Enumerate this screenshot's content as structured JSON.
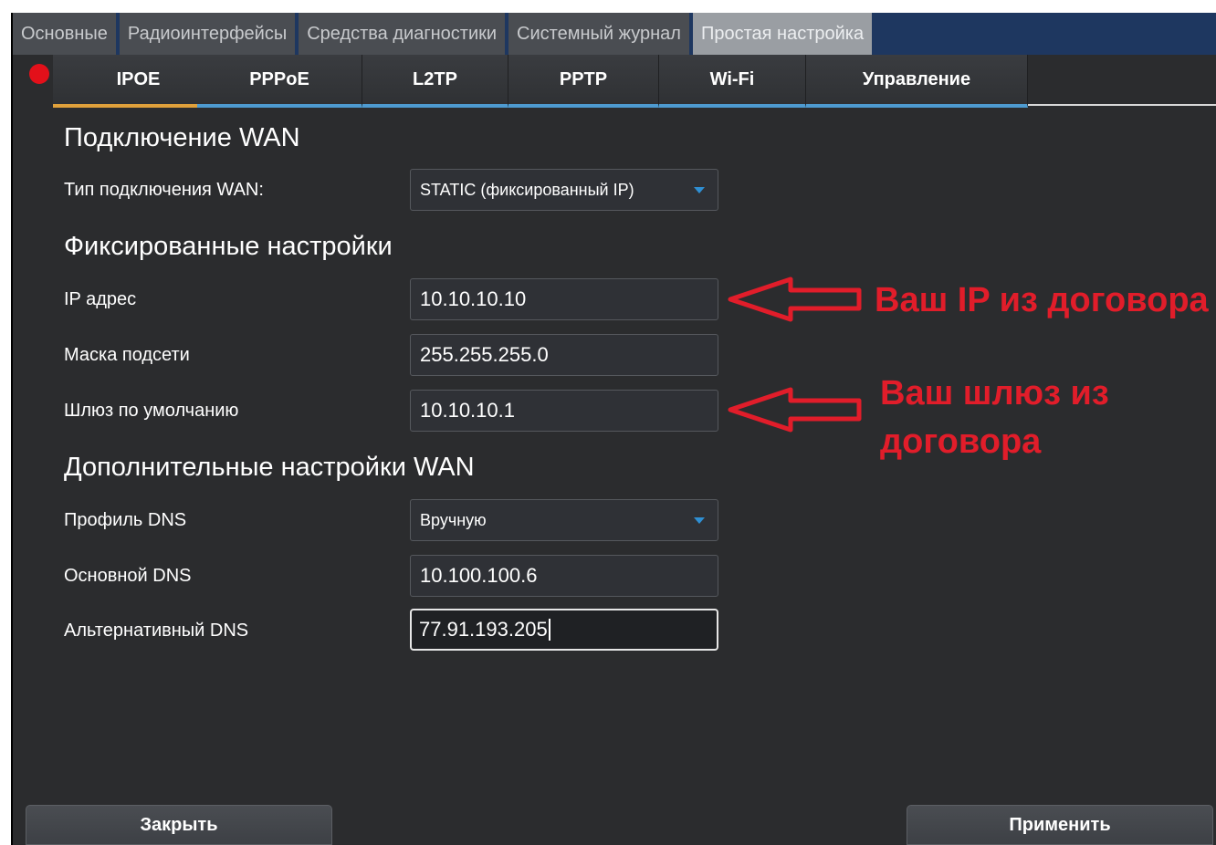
{
  "top_tabs": [
    "Основные",
    "Радиоинтерфейсы",
    "Средства диагностики",
    "Системный журнал",
    "Простая настройка"
  ],
  "sub_tabs": [
    "IPOE",
    "PPPoE",
    "L2TP",
    "PPTP",
    "Wi-Fi",
    "Управление"
  ],
  "active_sub_tab": "IPOE",
  "sections": {
    "wan_connection": {
      "title": "Подключение WAN",
      "type_label": "Тип подключения WAN:",
      "type_value": "STATIC (фиксированный IP)"
    },
    "fixed": {
      "title": "Фиксированные настройки",
      "ip_label": "IP адрес",
      "ip_value": "10.10.10.10",
      "mask_label": "Маска подсети",
      "mask_value": "255.255.255.0",
      "gateway_label": "Шлюз по умолчанию",
      "gateway_value": "10.10.10.1"
    },
    "extra": {
      "title": "Дополнительные настройки WAN",
      "dns_profile_label": "Профиль DNS",
      "dns_profile_value": "Вручную",
      "primary_dns_label": "Основной DNS",
      "primary_dns_value": "10.100.100.6",
      "alt_dns_label": "Альтернативный DNS",
      "alt_dns_value": "77.91.193.205"
    }
  },
  "annotations": {
    "ip_note": "Ваш IP из договора",
    "gateway_note_line1": "Ваш шлюз из",
    "gateway_note_line2": "договора"
  },
  "buttons": {
    "close": "Закрыть",
    "apply": "Применить"
  },
  "colors": {
    "panel_bg": "#2b2c2e",
    "tab_underline": "#4e9bd0",
    "active_underline": "#e0a13b",
    "annotation_red": "#e11d2a"
  }
}
